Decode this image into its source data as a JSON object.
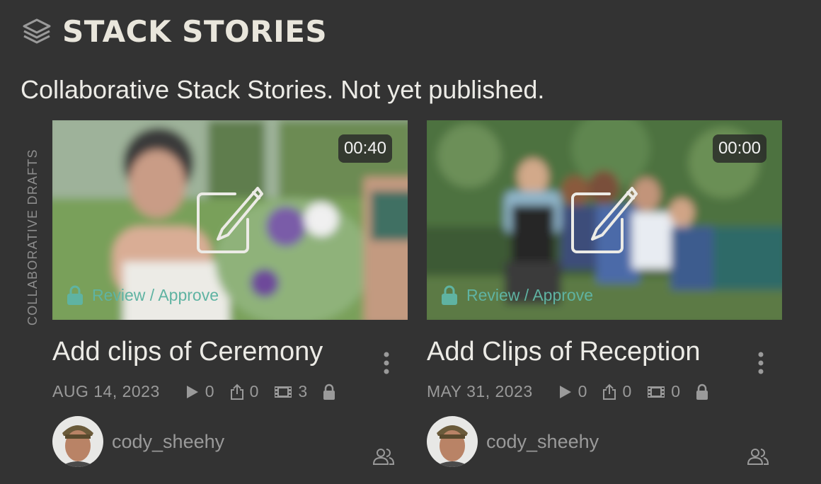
{
  "header": {
    "title": "STACK STORIES",
    "icon": "layers-icon"
  },
  "subtitle": "Collaborative Stack Stories. Not yet published.",
  "section_label": "COLLABORATIVE DRAFTS",
  "colors": {
    "background": "#333333",
    "accent": "#5fb3a2",
    "text": "#e9e6dc",
    "muted": "#9a9a9a"
  },
  "cards": [
    {
      "duration": "00:40",
      "status": "Review / Approve",
      "title": "Add clips of Ceremony",
      "date": "AUG 14, 2023",
      "plays": "0",
      "shares": "0",
      "clips": "3",
      "author": "cody_sheehy"
    },
    {
      "duration": "00:00",
      "status": "Review / Approve",
      "title": "Add Clips of Reception",
      "date": "MAY 31, 2023",
      "plays": "0",
      "shares": "0",
      "clips": "0",
      "author": "cody_sheehy"
    }
  ]
}
